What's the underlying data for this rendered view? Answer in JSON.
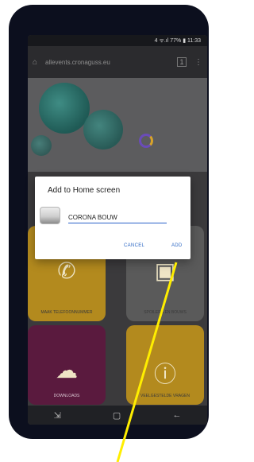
{
  "dialog": {
    "title": "Add to Home screen",
    "name_value": "CORONA BOUW",
    "cancel_label": "CANCEL",
    "add_label": "ADD"
  },
  "browser": {
    "url": "allevents.cronaguss.eu",
    "tab_count": "1"
  },
  "status_bar": {
    "text": "4 ᯤ.ıl 77% ▮ 11:33"
  },
  "tiles": [
    {
      "caption": "MAAK TELEFOONNUMMER"
    },
    {
      "caption": "SPOILERS EN BOUWS"
    },
    {
      "caption": "DOWNLOADS"
    },
    {
      "caption": "VEELGESTELDE VRAGEN"
    }
  ],
  "colors": {
    "accent": "#2c67c4",
    "tile_gold": "#b38a1e",
    "tile_maroon": "#5a1a3e",
    "pointer_line": "#ffee00"
  }
}
